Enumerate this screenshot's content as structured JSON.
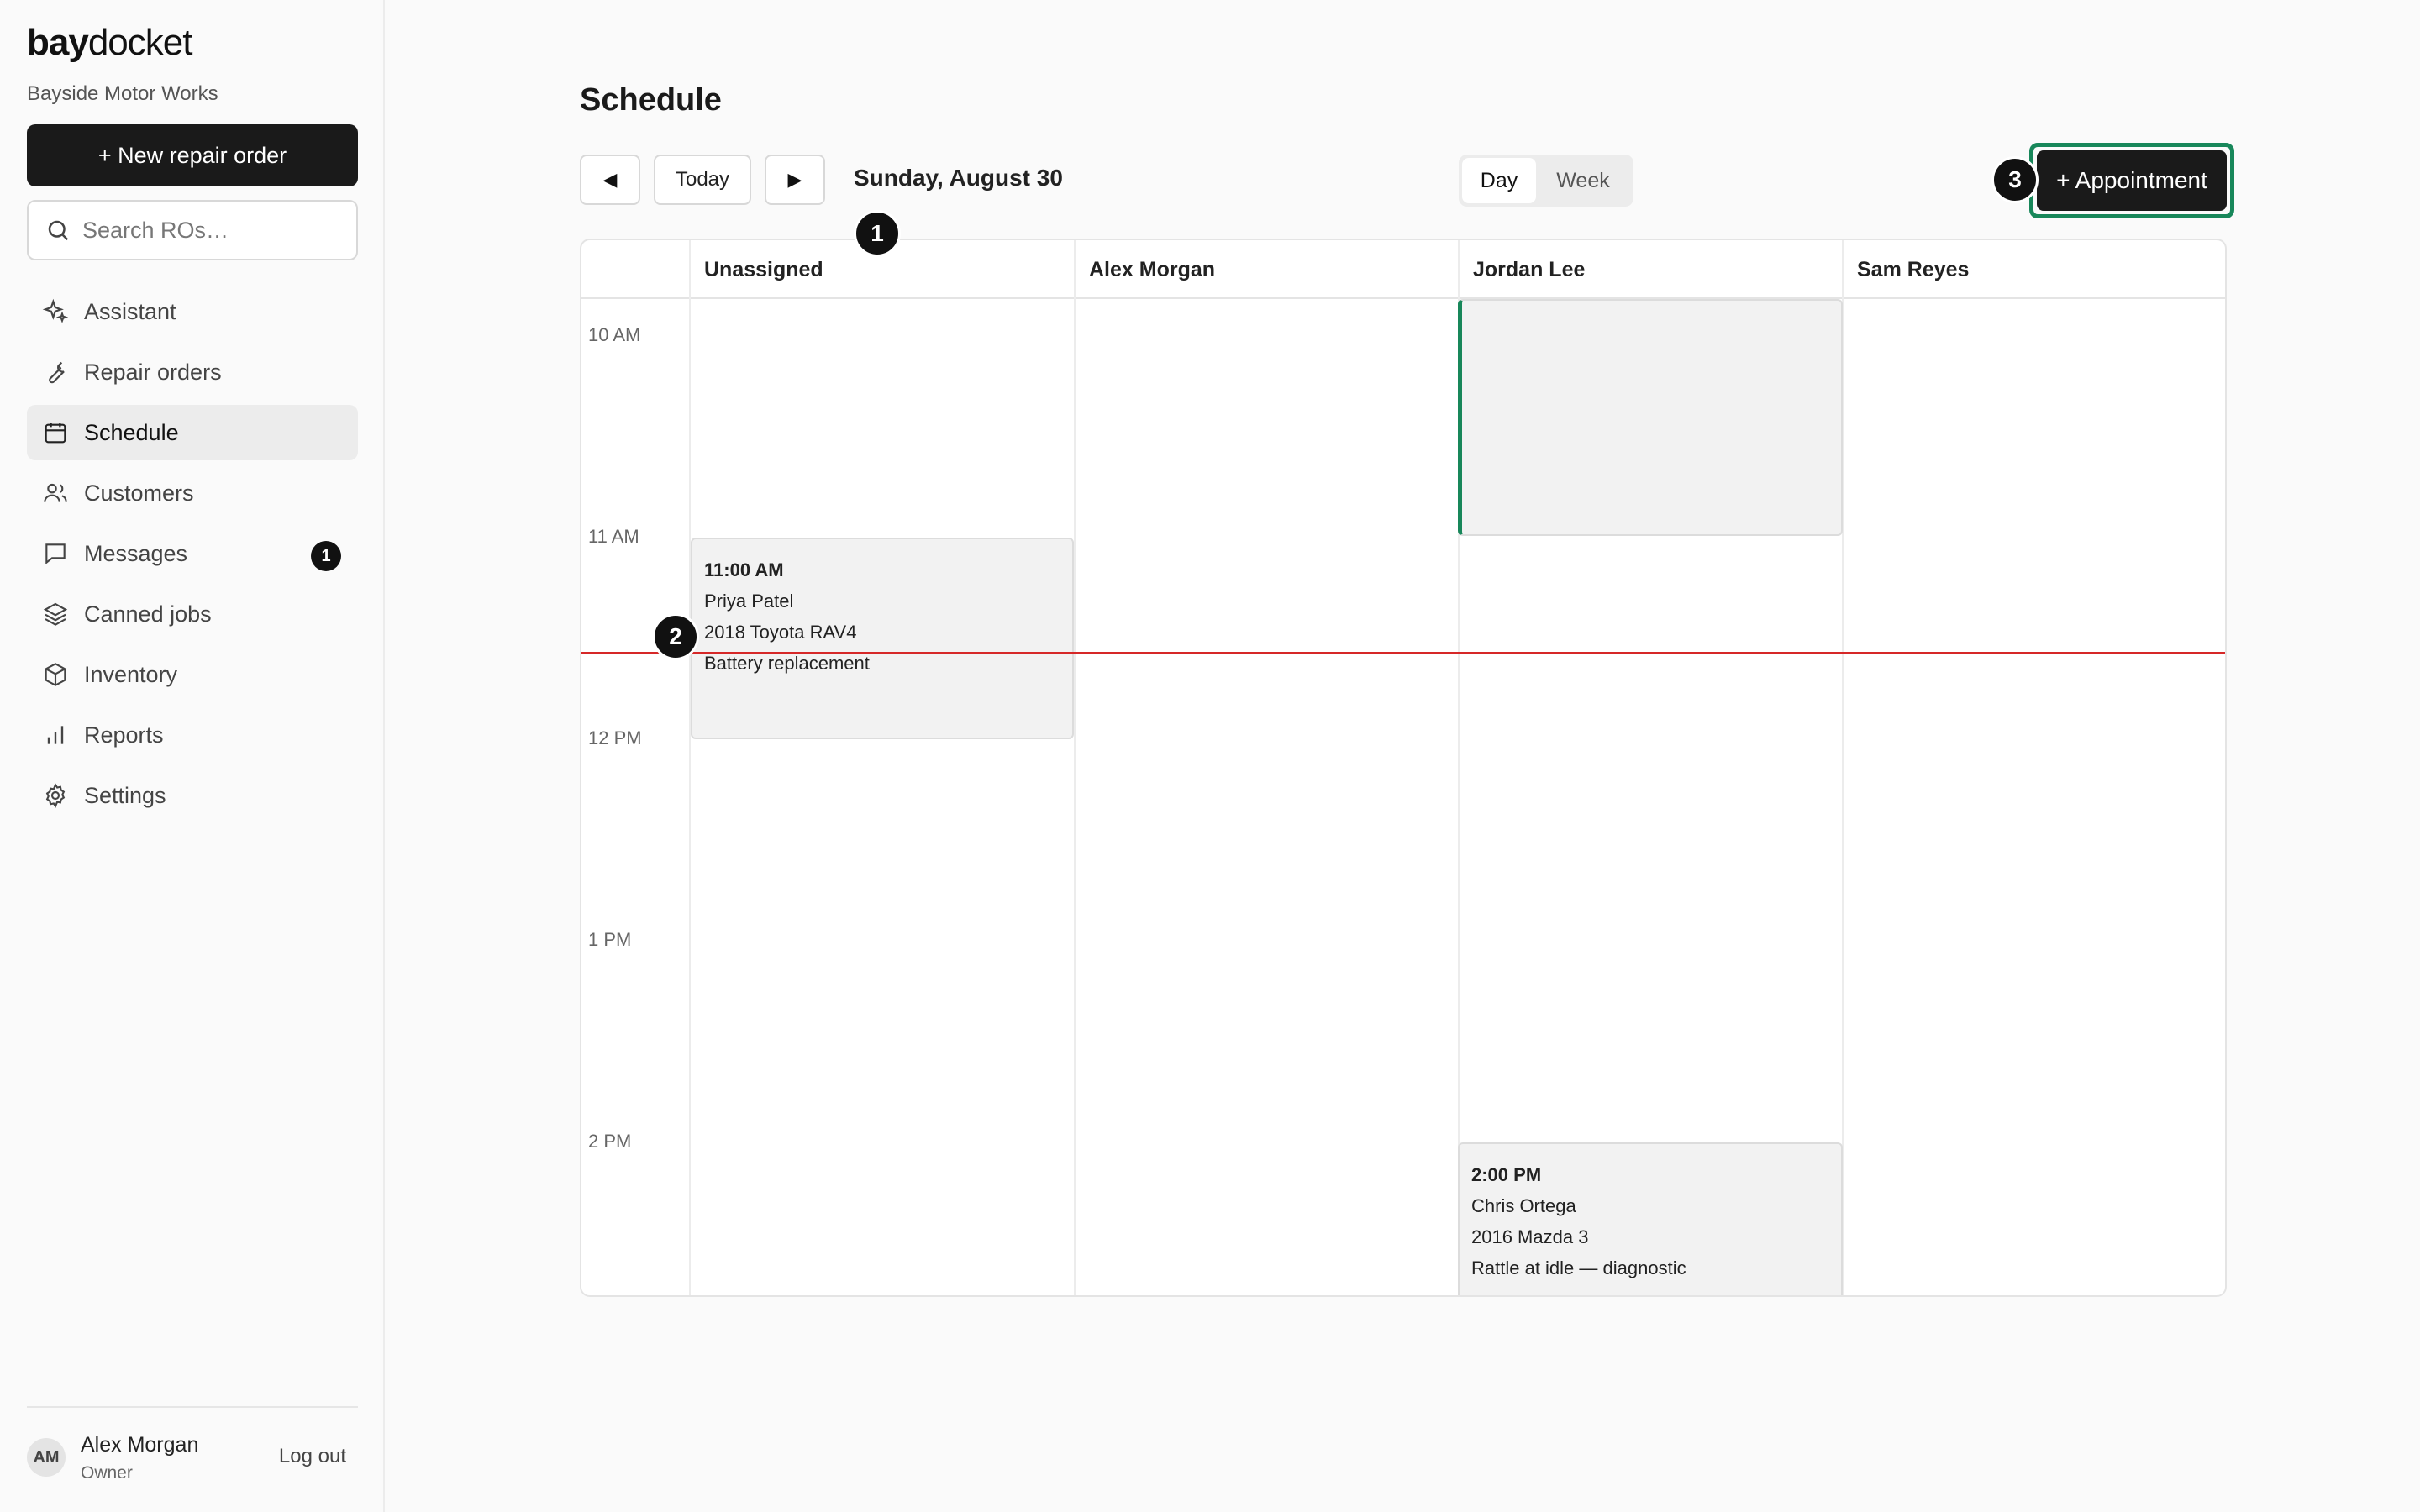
{
  "sidebar": {
    "brand_bold": "bay",
    "brand_light": "docket",
    "shop_name": "Bayside Motor Works",
    "new_button": "+  New repair order",
    "search_placeholder": "Search ROs…",
    "items": [
      {
        "label": "Assistant",
        "icon": "sparkle-icon"
      },
      {
        "label": "Repair orders",
        "icon": "wrench-icon"
      },
      {
        "label": "Schedule",
        "icon": "calendar-icon",
        "active": true
      },
      {
        "label": "Customers",
        "icon": "users-icon"
      },
      {
        "label": "Messages",
        "icon": "message-icon",
        "badge": "1"
      },
      {
        "label": "Canned jobs",
        "icon": "layers-icon"
      },
      {
        "label": "Inventory",
        "icon": "box-icon"
      },
      {
        "label": "Reports",
        "icon": "bar-chart-icon"
      },
      {
        "label": "Settings",
        "icon": "gear-icon"
      }
    ],
    "user": {
      "initials": "AM",
      "name": "Alex Morgan",
      "role": "Owner",
      "logout": "Log out"
    }
  },
  "main": {
    "title": "Schedule",
    "prev_icon": "◀",
    "today": "Today",
    "next_icon": "▶",
    "date": "Sunday, August 30",
    "views": [
      "Day",
      "Week"
    ],
    "active_view": "Day",
    "add_button": "+ Appointment",
    "markers": [
      "1",
      "2",
      "3"
    ]
  },
  "calendar": {
    "columns": [
      "Unassigned",
      "Alex Morgan",
      "Jordan Lee",
      "Sam Reyes"
    ],
    "times": [
      "10 AM",
      "11 AM",
      "12 PM",
      "1 PM",
      "2 PM"
    ],
    "events": [
      {
        "time": "11:00 AM",
        "customer": "Priya Patel",
        "vehicle": "2018 Toyota RAV4",
        "service": "Battery replacement",
        "column": "Unassigned"
      },
      {
        "time": "2:00 PM",
        "customer": "Chris Ortega",
        "vehicle": "2016 Mazda 3",
        "service": "Rattle at idle — diagnostic",
        "column": "Jordan Lee"
      }
    ]
  },
  "colors": {
    "accent": "#18875a",
    "now_line": "#d62828",
    "primary": "#1a1a1a"
  }
}
